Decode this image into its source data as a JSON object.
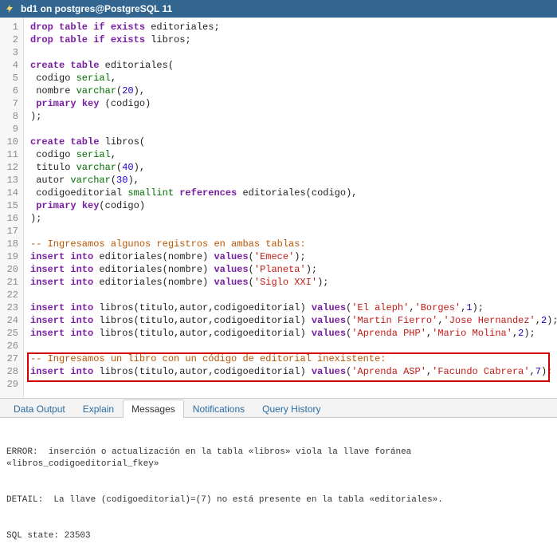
{
  "titlebar": {
    "icon_name": "bolt-icon",
    "title": "bd1 on postgres@PostgreSQL 11"
  },
  "editor": {
    "lines": [
      {
        "n": 1,
        "tokens": [
          [
            "kw",
            "drop table if exists"
          ],
          [
            "text",
            " editoriales;"
          ]
        ]
      },
      {
        "n": 2,
        "tokens": [
          [
            "kw",
            "drop table if exists"
          ],
          [
            "text",
            " libros;"
          ]
        ]
      },
      {
        "n": 3,
        "tokens": []
      },
      {
        "n": 4,
        "tokens": [
          [
            "kw",
            "create table"
          ],
          [
            "text",
            " editoriales("
          ]
        ]
      },
      {
        "n": 5,
        "tokens": [
          [
            "text",
            " codigo "
          ],
          [
            "type",
            "serial"
          ],
          [
            "text",
            ","
          ]
        ]
      },
      {
        "n": 6,
        "tokens": [
          [
            "text",
            " nombre "
          ],
          [
            "type",
            "varchar"
          ],
          [
            "text",
            "("
          ],
          [
            "num",
            "20"
          ],
          [
            "text",
            "),"
          ]
        ]
      },
      {
        "n": 7,
        "tokens": [
          [
            "text",
            " "
          ],
          [
            "kw",
            "primary key"
          ],
          [
            "text",
            " (codigo)"
          ]
        ]
      },
      {
        "n": 8,
        "tokens": [
          [
            "text",
            ");"
          ]
        ]
      },
      {
        "n": 9,
        "tokens": []
      },
      {
        "n": 10,
        "tokens": [
          [
            "kw",
            "create table"
          ],
          [
            "text",
            " libros("
          ]
        ]
      },
      {
        "n": 11,
        "tokens": [
          [
            "text",
            " codigo "
          ],
          [
            "type",
            "serial"
          ],
          [
            "text",
            ","
          ]
        ]
      },
      {
        "n": 12,
        "tokens": [
          [
            "text",
            " titulo "
          ],
          [
            "type",
            "varchar"
          ],
          [
            "text",
            "("
          ],
          [
            "num",
            "40"
          ],
          [
            "text",
            "),"
          ]
        ]
      },
      {
        "n": 13,
        "tokens": [
          [
            "text",
            " autor "
          ],
          [
            "type",
            "varchar"
          ],
          [
            "text",
            "("
          ],
          [
            "num",
            "30"
          ],
          [
            "text",
            "),"
          ]
        ]
      },
      {
        "n": 14,
        "tokens": [
          [
            "text",
            " codigoeditorial "
          ],
          [
            "type",
            "smallint"
          ],
          [
            "text",
            " "
          ],
          [
            "kw",
            "references"
          ],
          [
            "text",
            " editoriales(codigo),"
          ]
        ]
      },
      {
        "n": 15,
        "tokens": [
          [
            "text",
            " "
          ],
          [
            "kw",
            "primary key"
          ],
          [
            "text",
            "(codigo)"
          ]
        ]
      },
      {
        "n": 16,
        "tokens": [
          [
            "text",
            ");"
          ]
        ]
      },
      {
        "n": 17,
        "tokens": []
      },
      {
        "n": 18,
        "tokens": [
          [
            "cmt",
            "-- Ingresamos algunos registros en ambas tablas:"
          ]
        ]
      },
      {
        "n": 19,
        "tokens": [
          [
            "kw",
            "insert into"
          ],
          [
            "text",
            " editoriales(nombre) "
          ],
          [
            "kw",
            "values"
          ],
          [
            "text",
            "("
          ],
          [
            "str",
            "'Emece'"
          ],
          [
            "text",
            ");"
          ]
        ]
      },
      {
        "n": 20,
        "tokens": [
          [
            "kw",
            "insert into"
          ],
          [
            "text",
            " editoriales(nombre) "
          ],
          [
            "kw",
            "values"
          ],
          [
            "text",
            "("
          ],
          [
            "str",
            "'Planeta'"
          ],
          [
            "text",
            ");"
          ]
        ]
      },
      {
        "n": 21,
        "tokens": [
          [
            "kw",
            "insert into"
          ],
          [
            "text",
            " editoriales(nombre) "
          ],
          [
            "kw",
            "values"
          ],
          [
            "text",
            "("
          ],
          [
            "str",
            "'Siglo XXI'"
          ],
          [
            "text",
            ");"
          ]
        ]
      },
      {
        "n": 22,
        "tokens": []
      },
      {
        "n": 23,
        "tokens": [
          [
            "kw",
            "insert into"
          ],
          [
            "text",
            " libros(titulo,autor,codigoeditorial) "
          ],
          [
            "kw",
            "values"
          ],
          [
            "text",
            "("
          ],
          [
            "str",
            "'El aleph'"
          ],
          [
            "text",
            ","
          ],
          [
            "str",
            "'Borges'"
          ],
          [
            "text",
            ","
          ],
          [
            "num",
            "1"
          ],
          [
            "text",
            ");"
          ]
        ]
      },
      {
        "n": 24,
        "tokens": [
          [
            "kw",
            "insert into"
          ],
          [
            "text",
            " libros(titulo,autor,codigoeditorial) "
          ],
          [
            "kw",
            "values"
          ],
          [
            "text",
            "("
          ],
          [
            "str",
            "'Martin Fierro'"
          ],
          [
            "text",
            ","
          ],
          [
            "str",
            "'Jose Hernandez'"
          ],
          [
            "text",
            ","
          ],
          [
            "num",
            "2"
          ],
          [
            "text",
            ");"
          ]
        ]
      },
      {
        "n": 25,
        "tokens": [
          [
            "kw",
            "insert into"
          ],
          [
            "text",
            " libros(titulo,autor,codigoeditorial) "
          ],
          [
            "kw",
            "values"
          ],
          [
            "text",
            "("
          ],
          [
            "str",
            "'Aprenda PHP'"
          ],
          [
            "text",
            ","
          ],
          [
            "str",
            "'Mario Molina'"
          ],
          [
            "text",
            ","
          ],
          [
            "num",
            "2"
          ],
          [
            "text",
            ");"
          ]
        ]
      },
      {
        "n": 26,
        "tokens": []
      },
      {
        "n": 27,
        "tokens": [
          [
            "cmt",
            "-- Ingresamos un libro con un código de editorial inexistente:"
          ]
        ]
      },
      {
        "n": 28,
        "tokens": [
          [
            "kw",
            "insert into"
          ],
          [
            "text",
            " libros(titulo,autor,codigoeditorial) "
          ],
          [
            "kw",
            "values"
          ],
          [
            "text",
            "("
          ],
          [
            "str",
            "'Aprenda ASP'"
          ],
          [
            "text",
            ","
          ],
          [
            "str",
            "'Facundo Cabrera'"
          ],
          [
            "text",
            ","
          ],
          [
            "num",
            "7"
          ],
          [
            "text",
            ");"
          ]
        ]
      },
      {
        "n": 29,
        "tokens": []
      }
    ]
  },
  "tabs": {
    "items": [
      {
        "label": "Data Output",
        "active": false
      },
      {
        "label": "Explain",
        "active": false
      },
      {
        "label": "Messages",
        "active": true
      },
      {
        "label": "Notifications",
        "active": false
      },
      {
        "label": "Query History",
        "active": false
      }
    ]
  },
  "messages": {
    "error_line": "ERROR:  inserción o actualización en la tabla «libros» viola la llave foránea «libros_codigoeditorial_fkey»",
    "detail_line": "DETAIL:  La llave (codigoeditorial)=(7) no está presente en la tabla «editoriales».",
    "state_line": "SQL state: 23503"
  }
}
